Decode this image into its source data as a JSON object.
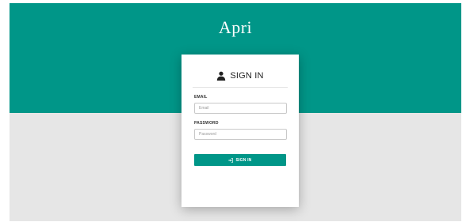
{
  "brand": {
    "title": "Apri"
  },
  "login_card": {
    "title": "SIGN IN",
    "title_icon": "user-icon",
    "email": {
      "label": "EMAIL",
      "placeholder": "Email",
      "value": ""
    },
    "password": {
      "label": "PASSWORD",
      "placeholder": "Password",
      "value": ""
    },
    "submit": {
      "label": "SIGN IN",
      "icon": "sign-in-icon"
    }
  },
  "colors": {
    "accent": "#009688",
    "background": "#e6e6e6",
    "card": "#ffffff"
  }
}
